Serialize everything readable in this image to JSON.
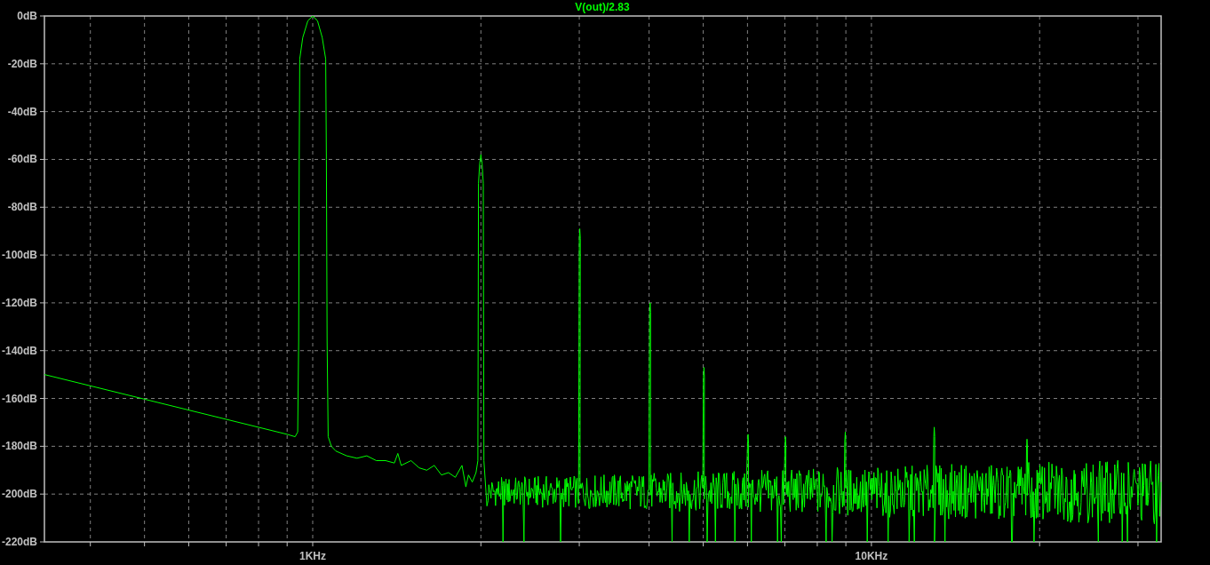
{
  "plot": {
    "trace_label": "V(out)/2.83",
    "y_axis_labels": [
      "0dB",
      "-20dB",
      "-40dB",
      "-60dB",
      "-80dB",
      "-100dB",
      "-120dB",
      "-140dB",
      "-160dB",
      "-180dB",
      "-200dB",
      "-220dB"
    ],
    "x_axis_labels": [
      "1KHz",
      "10KHz"
    ]
  }
}
